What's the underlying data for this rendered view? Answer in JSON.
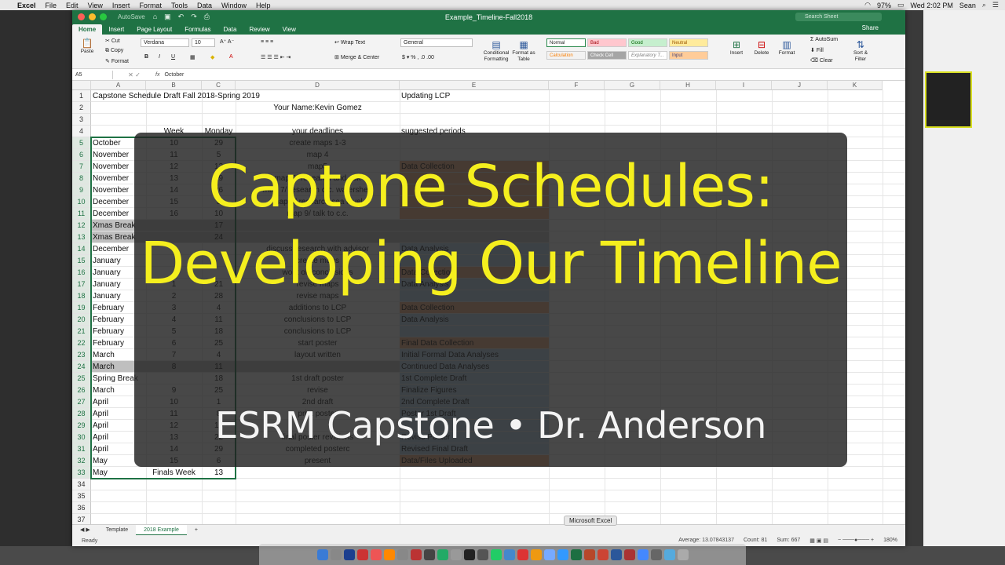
{
  "menubar": {
    "app": "Excel",
    "items": [
      "File",
      "Edit",
      "View",
      "Insert",
      "Format",
      "Tools",
      "Data",
      "Window",
      "Help"
    ],
    "clock": "Wed 2:02 PM",
    "user": "Sean",
    "battery": "97%"
  },
  "window": {
    "autosave": "AutoSave",
    "doc_title": "Example_Timeline-Fall2018",
    "search_placeholder": "Search Sheet",
    "share": "Share",
    "tabs": [
      "Home",
      "Insert",
      "Page Layout",
      "Formulas",
      "Data",
      "Review",
      "View"
    ]
  },
  "ribbon": {
    "paste": "Paste",
    "cut": "Cut",
    "copy": "Copy",
    "format": "Format",
    "font": "Verdana",
    "size": "10",
    "wrap": "Wrap Text",
    "merge": "Merge & Center",
    "number_format": "General",
    "cond_format": "Conditional Formatting",
    "format_table": "Format as Table",
    "styles": [
      "Normal",
      "Bad",
      "Good",
      "Neutral",
      "Calculation",
      "Check Cell",
      "Explanatory T...",
      "Input"
    ],
    "insert": "Insert",
    "delete": "Delete",
    "format_cells": "Format",
    "autosum": "AutoSum",
    "fill": "Fill",
    "clear": "Clear",
    "sort": "Sort & Filter"
  },
  "formula_bar": {
    "name_box": "A5",
    "fx": "fx",
    "content": "October"
  },
  "columns": [
    "A",
    "B",
    "C",
    "D",
    "E",
    "F",
    "G",
    "H",
    "I",
    "J",
    "K"
  ],
  "rows": [
    {
      "n": "1",
      "a": "Capstone Schedule Draft Fall 2018-Spring 2019",
      "b": "",
      "c": "",
      "d": "",
      "e": "Updating LCP"
    },
    {
      "n": "2",
      "a": "",
      "b": "",
      "c": "",
      "d": "Your Name:Kevin Gomez",
      "e": ""
    },
    {
      "n": "3",
      "a": "",
      "b": "",
      "c": "",
      "d": "",
      "e": ""
    },
    {
      "n": "4",
      "a": "",
      "b": "Week",
      "c": "Monday",
      "d": "your deadlines",
      "e": "suggested periods"
    },
    {
      "n": "5",
      "a": "October",
      "b": "10",
      "c": "29",
      "d": "create maps 1-3",
      "e": ""
    },
    {
      "n": "6",
      "a": "November",
      "b": "11",
      "c": "5",
      "d": "map 4",
      "e": ""
    },
    {
      "n": "7",
      "a": "November",
      "b": "12",
      "c": "12",
      "d": "map5",
      "e": "Data Collection"
    },
    {
      "n": "8",
      "a": "November",
      "b": "13",
      "c": "19",
      "d": "map 6/ research and ask",
      "e": ""
    },
    {
      "n": "9",
      "a": "November",
      "b": "14",
      "c": "26",
      "d": "map 7/ research c.c. watershed",
      "e": ""
    },
    {
      "n": "10",
      "a": "December",
      "b": "15",
      "c": "3",
      "d": "map 8/ research sea level",
      "e": ""
    },
    {
      "n": "11",
      "a": "December",
      "b": "16",
      "c": "10",
      "d": "map 9/ talk to c.c.",
      "e": ""
    },
    {
      "n": "12",
      "a": "Xmas Break",
      "b": "",
      "c": "17",
      "d": "",
      "e": ""
    },
    {
      "n": "13",
      "a": "Xmas Break",
      "b": "",
      "c": "24",
      "d": "",
      "e": ""
    },
    {
      "n": "14",
      "a": "December",
      "b": "",
      "c": "",
      "d": "discuss research with advisor",
      "e": "Data Analysis"
    },
    {
      "n": "15",
      "a": "January",
      "b": "",
      "c": "",
      "d": "create maps",
      "e": ""
    },
    {
      "n": "16",
      "a": "January",
      "b": "",
      "c": "",
      "d": "work on conclusions",
      "e": "Data Collection"
    },
    {
      "n": "17",
      "a": "January",
      "b": "1",
      "c": "21",
      "d": "revise maps",
      "e": "Data Analysis"
    },
    {
      "n": "18",
      "a": "January",
      "b": "2",
      "c": "28",
      "d": "revise maps",
      "e": ""
    },
    {
      "n": "19",
      "a": "February",
      "b": "3",
      "c": "4",
      "d": "additions to LCP",
      "e": "Data Collection"
    },
    {
      "n": "20",
      "a": "February",
      "b": "4",
      "c": "11",
      "d": "conclusions to LCP",
      "e": "Data Analysis"
    },
    {
      "n": "21",
      "a": "February",
      "b": "5",
      "c": "18",
      "d": "conclusions to LCP",
      "e": ""
    },
    {
      "n": "22",
      "a": "February",
      "b": "6",
      "c": "25",
      "d": "start poster",
      "e": "Final Data Collection"
    },
    {
      "n": "23",
      "a": "March",
      "b": "7",
      "c": "4",
      "d": "layout written",
      "e": "Initial Formal Data Analyses"
    },
    {
      "n": "24",
      "a": "March",
      "b": "8",
      "c": "11",
      "d": "",
      "e": "Continued Data Analyses"
    },
    {
      "n": "25",
      "a": "Spring Break",
      "b": "",
      "c": "18",
      "d": "1st draft poster",
      "e": "1st Complete Draft"
    },
    {
      "n": "26",
      "a": "March",
      "b": "9",
      "c": "25",
      "d": "revise",
      "e": "Finalize Figures"
    },
    {
      "n": "27",
      "a": "April",
      "b": "10",
      "c": "1",
      "d": "2nd draft",
      "e": "2nd Complete Draft"
    },
    {
      "n": "28",
      "a": "April",
      "b": "11",
      "c": "8",
      "d": "print poster",
      "e": "Poster 1st Draft"
    },
    {
      "n": "29",
      "a": "April",
      "b": "12",
      "c": "15",
      "d": "",
      "e": ""
    },
    {
      "n": "30",
      "a": "April",
      "b": "13",
      "c": "22",
      "d": "final poster revisions",
      "e": "Revise Poster"
    },
    {
      "n": "31",
      "a": "April",
      "b": "14",
      "c": "29",
      "d": "completed posterc",
      "e": "Revised Final Draft"
    },
    {
      "n": "32",
      "a": "May",
      "b": "15",
      "c": "6",
      "d": "present",
      "e": "Data/Files Uploaded"
    },
    {
      "n": "33",
      "a": "May",
      "b": "Finals Week",
      "c": "13",
      "d": "",
      "e": ""
    },
    {
      "n": "34",
      "a": "",
      "b": "",
      "c": "",
      "d": "",
      "e": ""
    },
    {
      "n": "35",
      "a": "",
      "b": "",
      "c": "",
      "d": "",
      "e": ""
    },
    {
      "n": "36",
      "a": "",
      "b": "",
      "c": "",
      "d": "",
      "e": ""
    },
    {
      "n": "37",
      "a": "",
      "b": "",
      "c": "",
      "d": "",
      "e": ""
    }
  ],
  "sheet_tabs": [
    "Template",
    "2018 Example"
  ],
  "status": {
    "ready": "Ready",
    "average": "Average: 13.07843137",
    "count": "Count: 81",
    "sum": "Sum: 667",
    "zoom": "180%"
  },
  "dock_tooltip": "Microsoft Excel",
  "overlay": {
    "line1": "Captone Schedules:",
    "line2": "Developing Our Timeline",
    "subtitle": "ESRM Capstone • Dr. Anderson"
  },
  "colors": {
    "excel_green": "#1f7244",
    "title_yellow": "#f5ef1e",
    "overlay_bg": "#202020",
    "fill_orange": "#f4b183",
    "fill_blue": "#bdd7ee"
  }
}
